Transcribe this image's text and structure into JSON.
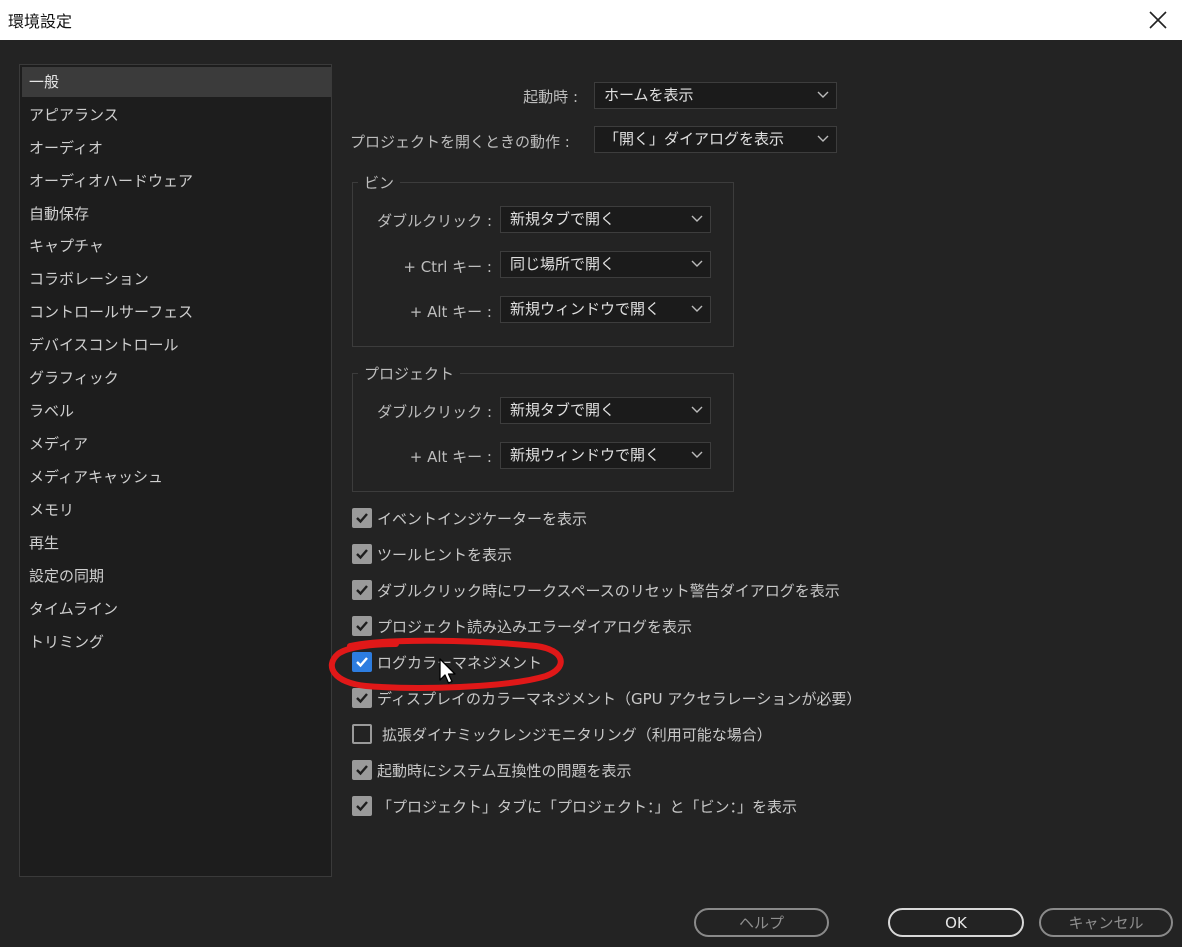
{
  "window": {
    "title": "環境設定"
  },
  "sidebar": {
    "items": [
      {
        "label": "一般",
        "selected": true
      },
      {
        "label": "アピアランス"
      },
      {
        "label": "オーディオ"
      },
      {
        "label": "オーディオハードウェア"
      },
      {
        "label": "自動保存"
      },
      {
        "label": "キャプチャ"
      },
      {
        "label": "コラボレーション"
      },
      {
        "label": "コントロールサーフェス"
      },
      {
        "label": "デバイスコントロール"
      },
      {
        "label": "グラフィック"
      },
      {
        "label": "ラベル"
      },
      {
        "label": "メディア"
      },
      {
        "label": "メディアキャッシュ"
      },
      {
        "label": "メモリ"
      },
      {
        "label": "再生"
      },
      {
        "label": "設定の同期"
      },
      {
        "label": "タイムライン"
      },
      {
        "label": "トリミング"
      }
    ]
  },
  "general": {
    "startup": {
      "label": "起動時 :",
      "value": "ホームを表示"
    },
    "open_project": {
      "label": "プロジェクトを開くときの動作 :",
      "value": "「開く」ダイアログを表示"
    }
  },
  "bin_group": {
    "title": "ビン",
    "double_click": {
      "label": "ダブルクリック :",
      "value": "新規タブで開く"
    },
    "ctrl_key": {
      "label": "+ Ctrl キー :",
      "value": "同じ場所で開く"
    },
    "alt_key": {
      "label": "+ Alt キー :",
      "value": "新規ウィンドウで開く"
    }
  },
  "project_group": {
    "title": "プロジェクト",
    "double_click": {
      "label": "ダブルクリック :",
      "value": "新規タブで開く"
    },
    "alt_key": {
      "label": "+ Alt キー :",
      "value": "新規ウィンドウで開く"
    }
  },
  "checkboxes": [
    {
      "label": "イベントインジケーターを表示",
      "checked": true
    },
    {
      "label": "ツールヒントを表示",
      "checked": true
    },
    {
      "label": "ダブルクリック時にワークスペースのリセット警告ダイアログを表示",
      "checked": true
    },
    {
      "label": "プロジェクト読み込みエラーダイアログを表示",
      "checked": true
    },
    {
      "label": "ログカラーマネジメント",
      "checked": true,
      "highlighted": true
    },
    {
      "label": "ディスプレイのカラーマネジメント（GPU アクセラレーションが必要）",
      "checked": true
    },
    {
      "label": "拡張ダイナミックレンジモニタリング（利用可能な場合）",
      "checked": false
    },
    {
      "label": "起動時にシステム互換性の問題を表示",
      "checked": true
    },
    {
      "label": "「プロジェクト」タブに「プロジェクト：」と「ビン：」を表示",
      "checked": true
    }
  ],
  "buttons": {
    "help": "ヘルプ",
    "ok": "OK",
    "cancel": "キャンセル"
  },
  "colors": {
    "background": "#232323",
    "checkbox_checked": "#9a9a9a",
    "checkbox_focus": "#2d7de0",
    "annotation": "#e01818"
  }
}
